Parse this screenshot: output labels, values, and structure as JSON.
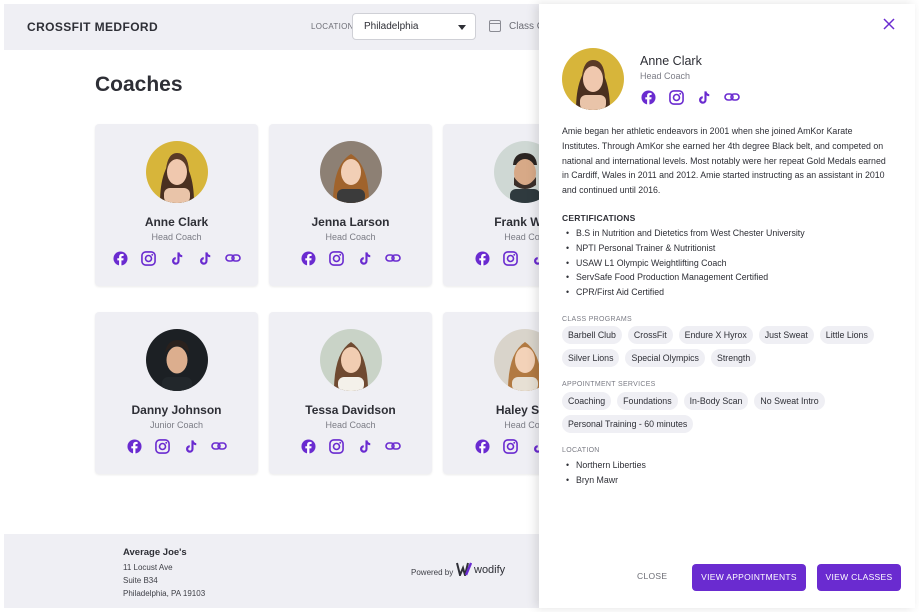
{
  "header": {
    "brand": "CROSSFIT MEDFORD",
    "location_label": "LOCATION",
    "location_value": "Philadelphia",
    "class_label": "Class C"
  },
  "page": {
    "title": "Coaches"
  },
  "coaches": [
    {
      "name": "Anne Clark",
      "role": "Head Coach",
      "socials": [
        "facebook-icon",
        "instagram-icon",
        "tiktok-icon",
        "tiktok-icon",
        "link-icon"
      ]
    },
    {
      "name": "Jenna Larson",
      "role": "Head Coach",
      "socials": [
        "facebook-icon",
        "instagram-icon",
        "tiktok-icon",
        "link-icon"
      ]
    },
    {
      "name": "Frank Willi",
      "role": "Head Coa",
      "socials": [
        "facebook-icon",
        "instagram-icon",
        "tiktok-icon",
        "link-icon"
      ]
    },
    {
      "name": "Danny Johnson",
      "role": "Junior Coach",
      "socials": [
        "facebook-icon",
        "instagram-icon",
        "tiktok-icon",
        "link-icon"
      ]
    },
    {
      "name": "Tessa Davidson",
      "role": "Head Coach",
      "socials": [
        "facebook-icon",
        "instagram-icon",
        "tiktok-icon",
        "link-icon"
      ]
    },
    {
      "name": "Haley Sco",
      "role": "Head Coa",
      "socials": [
        "facebook-icon",
        "instagram-icon",
        "tiktok-icon",
        "link-icon"
      ]
    }
  ],
  "footer": {
    "name": "Average Joe's",
    "address": [
      "11 Locust Ave",
      "Suite B34",
      "Philadelphia, PA 19103"
    ],
    "powered_by": "Powered by",
    "brand": "wodify"
  },
  "panel": {
    "name": "Anne Clark",
    "role": "Head Coach",
    "bio": "Amie began her athletic endeavors in 2001 when she joined AmKor Karate Institutes. Through AmKor she earned her 4th degree Black belt, and competed on national and international levels. Most notably were her repeat Gold Medals earned in Cardiff, Wales in 2011 and 2012. Amie started instructing as an assistant in 2010 and continued until 2016.",
    "certifications_title": "CERTIFICATIONS",
    "certifications": [
      "B.S in Nutrition and Dietetics from West Chester University",
      "NPTI Personal Trainer & Nutritionist",
      "USAW L1 Olympic Weightlifting Coach",
      "ServSafe Food Production Management Certified",
      "CPR/First Aid Certified"
    ],
    "programs_title": "CLASS PROGRAMS",
    "programs": [
      "Barbell Club",
      "CrossFit",
      "Endure X Hyrox",
      "Just Sweat",
      "Little Lions",
      "Silver Lions",
      "Special Olympics",
      "Strength"
    ],
    "services_title": "APPOINTMENT SERVICES",
    "services": [
      "Coaching",
      "Foundations",
      "In-Body Scan",
      "No Sweat Intro",
      "Personal Training - 60 minutes"
    ],
    "location_title": "LOCATION",
    "locations": [
      "Northern Liberties",
      "Bryn Mawr"
    ],
    "close_label": "CLOSE",
    "appointments_label": "VIEW APPOINTMENTS",
    "classes_label": "VIEW CLASSES"
  },
  "colors": {
    "accent": "#6a2bd0",
    "surface": "#efeff4",
    "text": "#2e2f36"
  }
}
